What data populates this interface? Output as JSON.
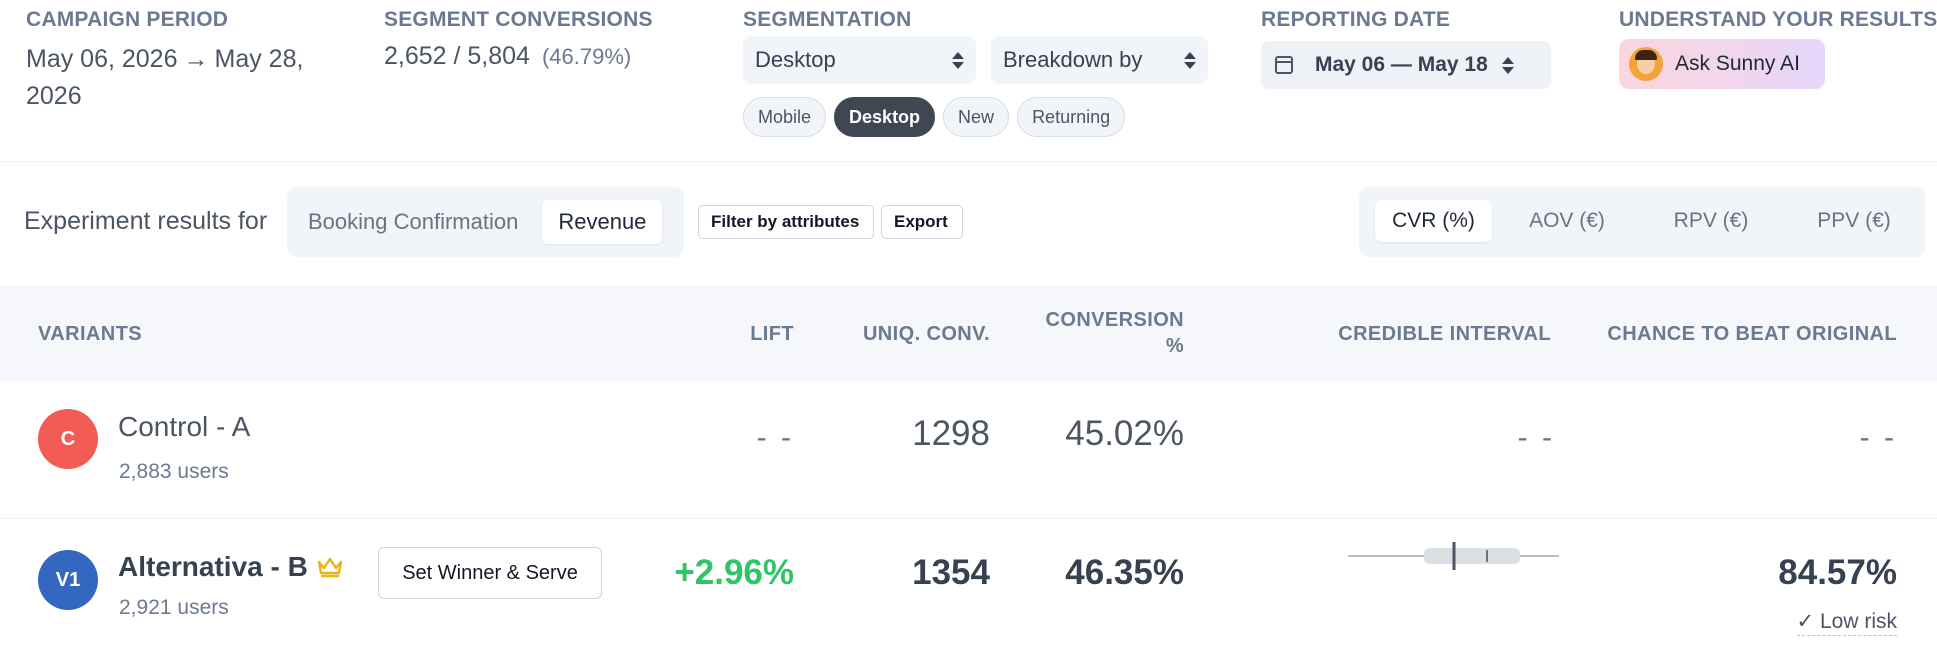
{
  "header": {
    "campaign_period": {
      "label": "CAMPAIGN PERIOD",
      "start": "May 06, 2026",
      "arrow": "→",
      "end": "May 28, 2026"
    },
    "segment_conversions": {
      "label": "SEGMENT CONVERSIONS",
      "value": "2,652 / 5,804",
      "percent": "(46.79%)"
    },
    "segmentation": {
      "label": "SEGMENTATION",
      "device_select": "Desktop",
      "breakdown_select": "Breakdown by",
      "chips": [
        {
          "label": "Mobile",
          "active": false
        },
        {
          "label": "Desktop",
          "active": true
        },
        {
          "label": "New",
          "active": false
        },
        {
          "label": "Returning",
          "active": false
        }
      ]
    },
    "reporting_date": {
      "label": "REPORTING DATE",
      "value": "May 06 — May 18",
      "icon": "calendar-icon"
    },
    "understand": {
      "label": "UNDERSTAND YOUR RESULTS",
      "button": "Ask Sunny AI"
    }
  },
  "toolbar": {
    "experiment_label": "Experiment results for",
    "goals": [
      {
        "label": "Booking Confirmation",
        "active": false
      },
      {
        "label": "Revenue",
        "active": true
      }
    ],
    "filter_button": "Filter by attributes",
    "export_button": "Export",
    "metrics": [
      {
        "label": "CVR (%)",
        "active": true
      },
      {
        "label": "AOV (€)",
        "active": false
      },
      {
        "label": "RPV (€)",
        "active": false
      },
      {
        "label": "PPV (€)",
        "active": false
      }
    ]
  },
  "table": {
    "columns": {
      "variants": "VARIANTS",
      "lift": "LIFT",
      "uniq_conv": "UNIQ. CONV.",
      "conversion": "CONVERSION %",
      "credible_interval": "CREDIBLE INTERVAL",
      "chance": "CHANCE TO BEAT ORIGINAL"
    },
    "rows": [
      {
        "badge": "C",
        "badge_color": "#f25c54",
        "name": "Control - A",
        "users": "2,883 users",
        "lift": "- -",
        "uniq_conv": "1298",
        "conversion": "45.02%",
        "credible_interval": "- -",
        "chance": "- -"
      },
      {
        "badge": "V1",
        "badge_color": "#3468c0",
        "name": "Alternativa - B",
        "users": "2,921 users",
        "winner_icon": "crown-icon",
        "set_winner_button": "Set Winner & Serve",
        "lift": "+2.96%",
        "uniq_conv": "1354",
        "conversion": "46.35%",
        "chance": "84.57%",
        "risk": "✓ Low risk"
      }
    ]
  },
  "colors": {
    "positive": "#2fc466",
    "chip_active": "#3f4852",
    "control_badge": "#f25c54",
    "variant_badge": "#3468c0"
  }
}
